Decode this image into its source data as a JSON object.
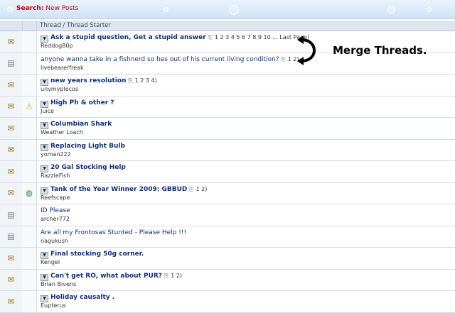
{
  "header": {
    "title_label": "Search:",
    "title_value": "New Posts"
  },
  "column_header": "Thread / Thread Starter",
  "annotation": "Merge Threads.",
  "threads": [
    {
      "title": "Ask a stupid question, Get a stupid answer",
      "bold": true,
      "pages": "1 2 3 4 5 6 7 8 9 10 ... Last Page)",
      "starter": "Reddog80p",
      "icon": "hot",
      "status_icon": ""
    },
    {
      "title": "anyone wanna take in a fishnerd so hes out of his current living condition?",
      "bold": false,
      "pages": "1 2)",
      "starter": "livebearerfreak",
      "icon": "normal",
      "status_icon": ""
    },
    {
      "title": "new years resolution",
      "bold": true,
      "pages": "1 2 3 4)",
      "starter": "unvmyplecos",
      "icon": "hot",
      "status_icon": ""
    },
    {
      "title": "High Ph & other ?",
      "bold": true,
      "pages": "",
      "starter": "Juice",
      "icon": "hot",
      "status_icon": "warning"
    },
    {
      "title": "Columbian Shark",
      "bold": true,
      "pages": "",
      "starter": "Weather Loach",
      "icon": "hot",
      "status_icon": ""
    },
    {
      "title": "Replacing Light Bulb",
      "bold": true,
      "pages": "",
      "starter": "yoman222",
      "icon": "hot",
      "status_icon": ""
    },
    {
      "title": "20 Gal Stocking Help",
      "bold": true,
      "pages": "",
      "starter": "RazzleFish",
      "icon": "hot",
      "status_icon": ""
    },
    {
      "title": "Tank of the Year Winner 2009: GBBUD",
      "bold": true,
      "pages": "1 2)",
      "starter": "Reefscape",
      "icon": "hot",
      "status_icon": "globe"
    },
    {
      "title": "ID Please",
      "bold": false,
      "pages": "",
      "starter": "archer772",
      "icon": "normal",
      "status_icon": ""
    },
    {
      "title": "Are all my Frontosas Stunted - Please Help !!!",
      "bold": false,
      "pages": "",
      "starter": "nagukush",
      "icon": "normal",
      "status_icon": ""
    },
    {
      "title": "Final stocking 50g corner.",
      "bold": true,
      "pages": "",
      "starter": "Kengel",
      "icon": "hot",
      "status_icon": ""
    },
    {
      "title": "Can't get RO, what about PUR?",
      "bold": true,
      "pages": "1 2)",
      "starter": "Brian Bivens",
      "icon": "hot",
      "status_icon": ""
    },
    {
      "title": "Holiday causalty .",
      "bold": true,
      "pages": "",
      "starter": "Eupterus",
      "icon": "hot",
      "status_icon": ""
    }
  ]
}
